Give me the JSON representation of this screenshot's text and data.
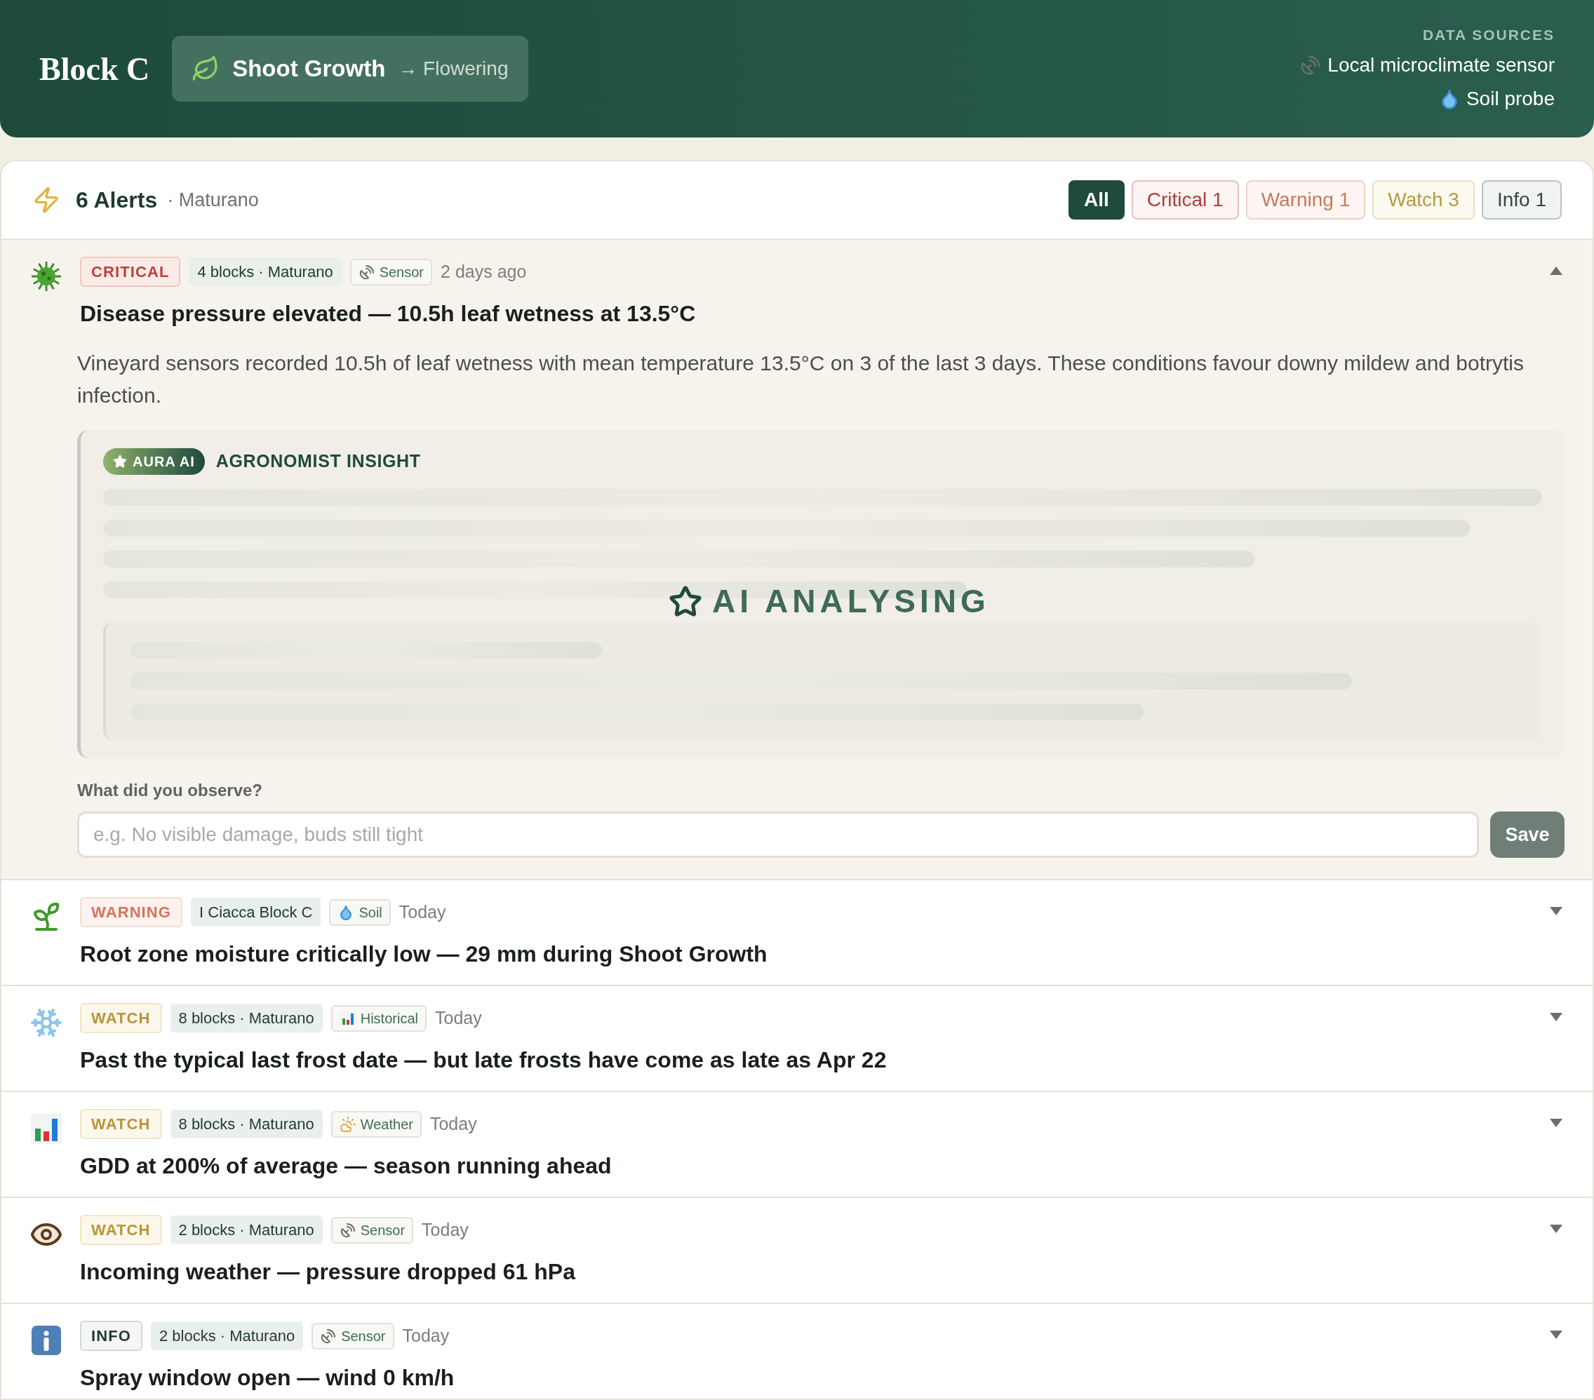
{
  "header": {
    "title": "Block C",
    "stage": "Shoot Growth",
    "next_stage": "→ Flowering",
    "sources_label": "DATA SOURCES",
    "sources": [
      {
        "kind": "sensor",
        "label": "Local microclimate sensor"
      },
      {
        "kind": "soil",
        "label": "Soil probe"
      }
    ]
  },
  "alerts_bar": {
    "count": "6 Alerts",
    "location": "· Maturano",
    "filters": [
      {
        "kind": "all",
        "label": "All",
        "selected": true
      },
      {
        "kind": "critical",
        "label": "Critical 1",
        "selected": false
      },
      {
        "kind": "warning",
        "label": "Warning 1",
        "selected": false
      },
      {
        "kind": "watch",
        "label": "Watch 3",
        "selected": false
      },
      {
        "kind": "info",
        "label": "Info 1",
        "selected": false
      }
    ]
  },
  "alerts": [
    {
      "kind": "critical",
      "severity_label": "CRITICAL",
      "location": "4 blocks · Maturano",
      "source": {
        "kind": "sensor",
        "label": "Sensor"
      },
      "time": "2 days ago",
      "title": "Disease pressure elevated — 10.5h leaf wetness at 13.5°C",
      "expanded": true,
      "details": {
        "description": "Vineyard sensors recorded 10.5h of leaf wetness with mean temperature 13.5°C on 3 of the last 3 days. These conditions favour downy mildew and botrytis infection.",
        "ai_badge": "AURA AI",
        "insight_label": "AGRONOMIST INSIGHT",
        "analysing": "AI ANALYSING",
        "observe_label": "What did you observe?",
        "observe_placeholder": "e.g. No visible damage, buds still tight",
        "save": "Save"
      }
    },
    {
      "kind": "warning",
      "severity_label": "WARNING",
      "location": "I Ciacca Block C",
      "source": {
        "kind": "soil",
        "label": "Soil"
      },
      "time": "Today",
      "title": "Root zone moisture critically low — 29 mm during Shoot Growth",
      "expanded": false
    },
    {
      "kind": "watch",
      "severity_label": "WATCH",
      "location": "8 blocks · Maturano",
      "source": {
        "kind": "historical",
        "label": "Historical"
      },
      "time": "Today",
      "title": "Past the typical last frost date — but late frosts have come as late as Apr 22",
      "expanded": false
    },
    {
      "kind": "watch",
      "severity_label": "WATCH",
      "location": "8 blocks · Maturano",
      "source": {
        "kind": "weather",
        "label": "Weather"
      },
      "time": "Today",
      "title": "GDD at 200% of average — season running ahead",
      "expanded": false
    },
    {
      "kind": "watch",
      "severity_label": "WATCH",
      "location": "2 blocks · Maturano",
      "source": {
        "kind": "sensor",
        "label": "Sensor"
      },
      "time": "Today",
      "title": "Incoming weather — pressure dropped 61 hPa",
      "expanded": false
    },
    {
      "kind": "info",
      "severity_label": "INFO",
      "location": "2 blocks · Maturano",
      "source": {
        "kind": "sensor",
        "label": "Sensor"
      },
      "time": "Today",
      "title": "Spray window open — wind 0 km/h",
      "expanded": false
    }
  ]
}
